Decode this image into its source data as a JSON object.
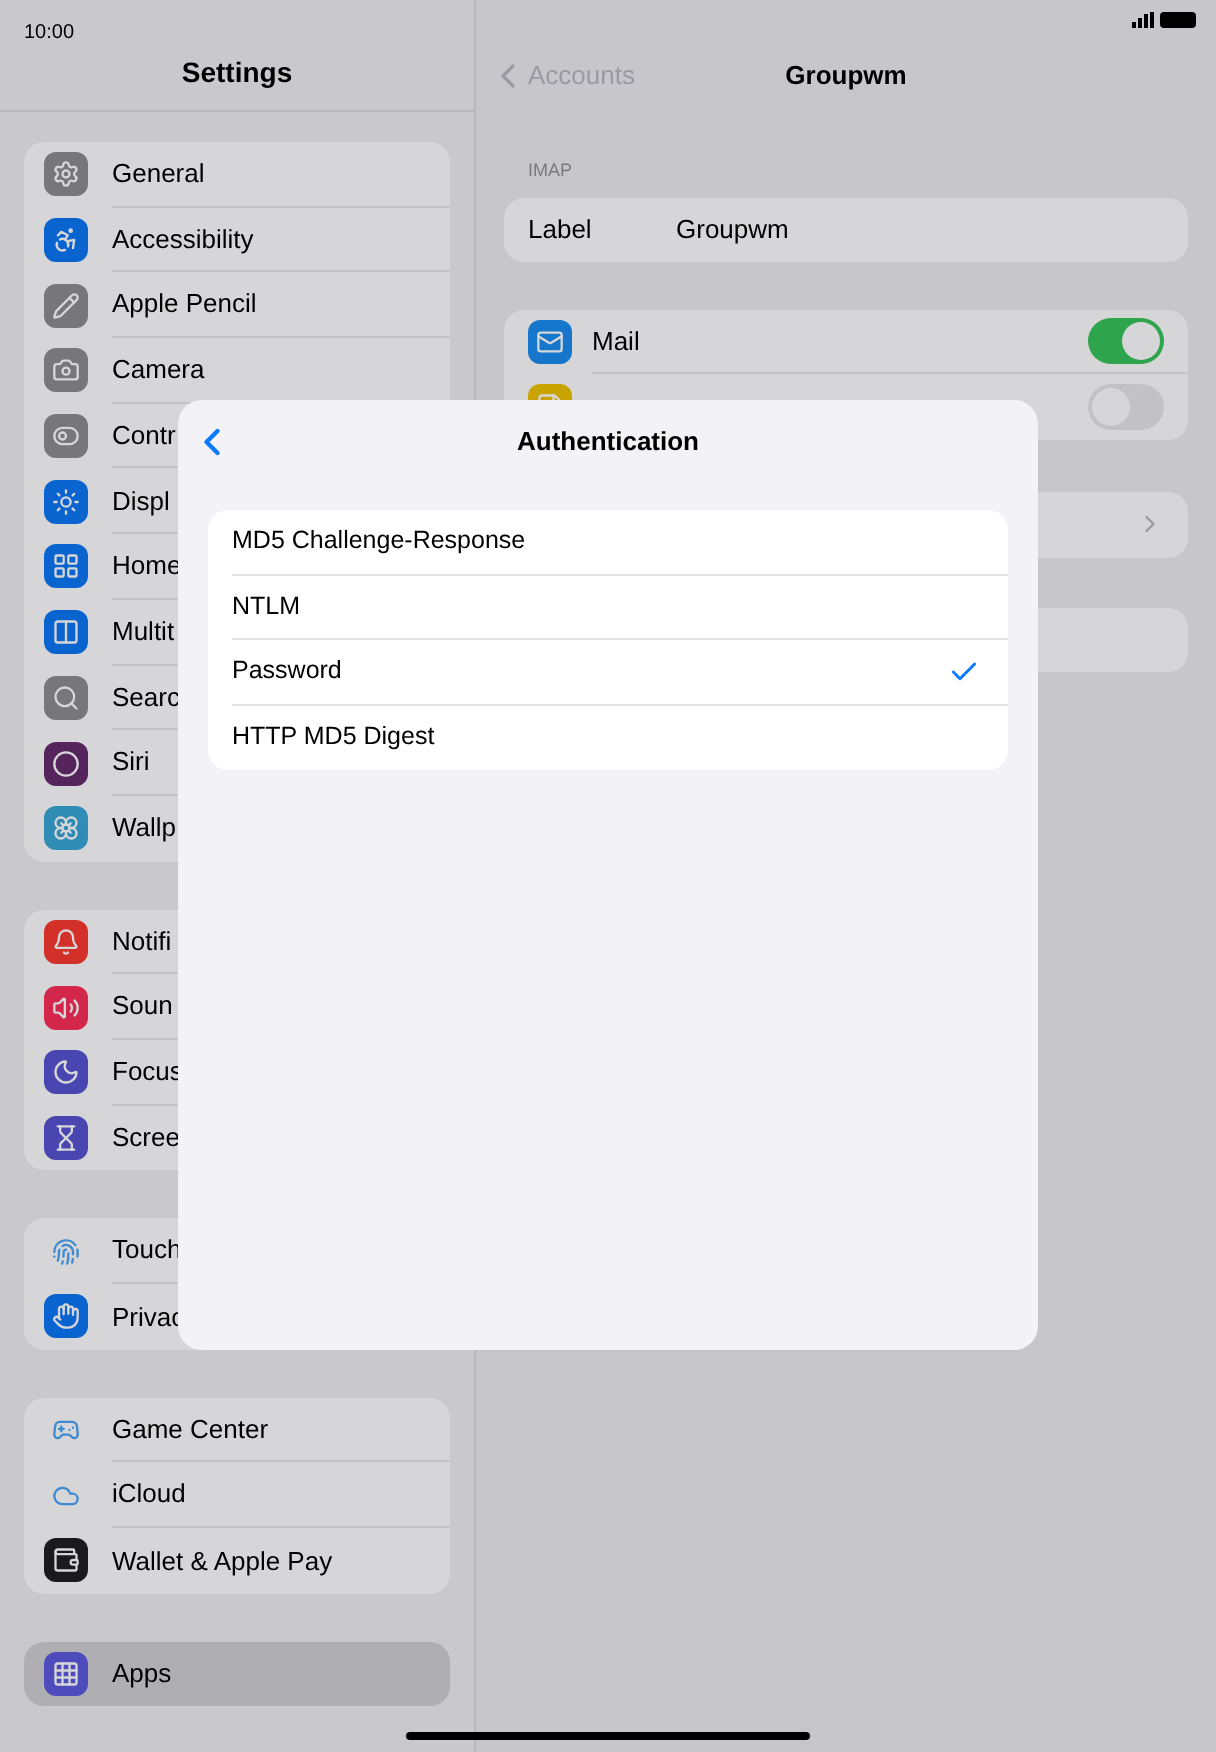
{
  "status_bar": {
    "time": "10:00"
  },
  "sidebar": {
    "title": "Settings",
    "groups": [
      [
        {
          "label": "General",
          "color": "#76767b",
          "selected": false
        },
        {
          "label": "Accessibility",
          "color": "#0a64cf",
          "selected": false
        },
        {
          "label": "Apple Pencil",
          "color": "#76767b",
          "selected": false
        },
        {
          "label": "Camera",
          "color": "#76767b",
          "selected": false
        },
        {
          "label": "Contr",
          "color": "#76767b",
          "selected": false
        },
        {
          "label": "Displ",
          "color": "#0a64cf",
          "selected": false
        },
        {
          "label": "Home",
          "color": "#0a64cf",
          "selected": false
        },
        {
          "label": "Multit",
          "color": "#0a64cf",
          "selected": false
        },
        {
          "label": "Searc",
          "color": "#76767b",
          "selected": false
        },
        {
          "label": "Siri",
          "color": "#56245c",
          "selected": false
        },
        {
          "label": "Wallp",
          "color": "#2f8cb5",
          "selected": false
        }
      ],
      [
        {
          "label": "Notifi",
          "color": "#d3302a",
          "selected": false
        },
        {
          "label": "Soun",
          "color": "#d2264a",
          "selected": false
        },
        {
          "label": "Focus",
          "color": "#4946b2",
          "selected": false
        },
        {
          "label": "Scree",
          "color": "#4946b2",
          "selected": false
        }
      ],
      [
        {
          "label": "Touch",
          "color": "#d6d6d8",
          "selected": false
        },
        {
          "label": "Privac",
          "color": "#0a64cf",
          "selected": false
        }
      ],
      [
        {
          "label": "Game Center",
          "color": "#d6d6d8",
          "selected": false
        },
        {
          "label": "iCloud",
          "color": "#d6d6d8",
          "selected": false
        },
        {
          "label": "Wallet & Apple Pay",
          "color": "#1a1a1c",
          "selected": false
        }
      ],
      [
        {
          "label": "Apps",
          "color": "#4e4cbc",
          "selected": true
        }
      ]
    ]
  },
  "detail": {
    "back": "Accounts",
    "title": "Groupwm",
    "section": "IMAP",
    "label_row": {
      "label": "Label",
      "value": "Groupwm"
    },
    "toggles": [
      {
        "label": "Mail",
        "on": true
      },
      {
        "on": false
      }
    ]
  },
  "modal": {
    "title": "Authentication",
    "options": [
      {
        "label": "MD5 Challenge-Response",
        "selected": false
      },
      {
        "label": "NTLM",
        "selected": false
      },
      {
        "label": "Password",
        "selected": true
      },
      {
        "label": "HTTP MD5 Digest",
        "selected": false
      }
    ]
  }
}
